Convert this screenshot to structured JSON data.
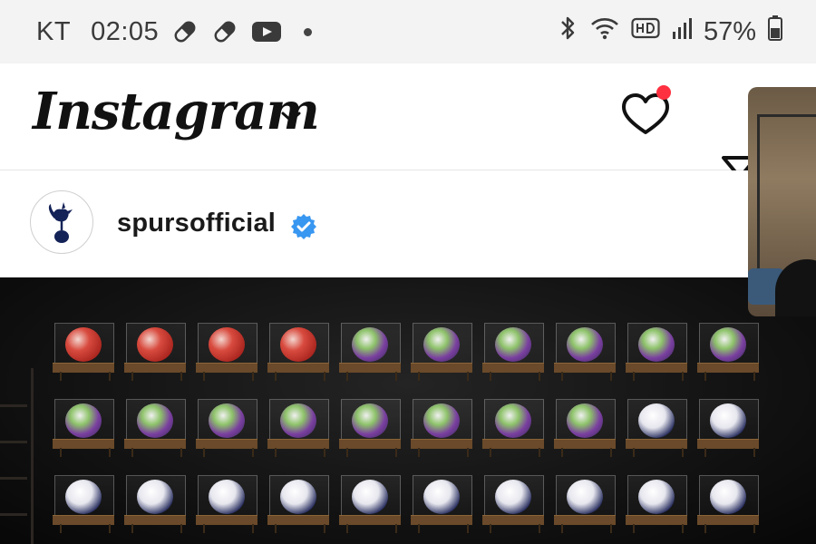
{
  "status_bar": {
    "carrier": "KT",
    "time": "02:05",
    "notification_icons": [
      "pill-icon",
      "pill-icon",
      "youtube-icon"
    ],
    "right_icons": [
      "bluetooth-icon",
      "wifi-icon",
      "hd-voice-icon",
      "signal-icon"
    ],
    "battery": "57%"
  },
  "header": {
    "logo": "Instagram",
    "icons": [
      "chevron-down-icon",
      "heart-icon",
      "filter-icon"
    ],
    "notification_color": "#ff3040"
  },
  "post": {
    "username": "spursofficial",
    "verified_color": "#3897f0"
  },
  "post_image": {
    "rows": [
      [
        "red",
        "red",
        "red",
        "red",
        "purple",
        "purple",
        "purple",
        "purple",
        "purple",
        "purple"
      ],
      [
        "purple",
        "purple",
        "purple",
        "purple",
        "purple",
        "purple",
        "purple",
        "purple",
        "white",
        "white"
      ],
      [
        "white",
        "white",
        "white",
        "white",
        "white",
        "white",
        "white",
        "white",
        "white",
        "white"
      ]
    ]
  },
  "pip_video": {
    "visible": true
  }
}
